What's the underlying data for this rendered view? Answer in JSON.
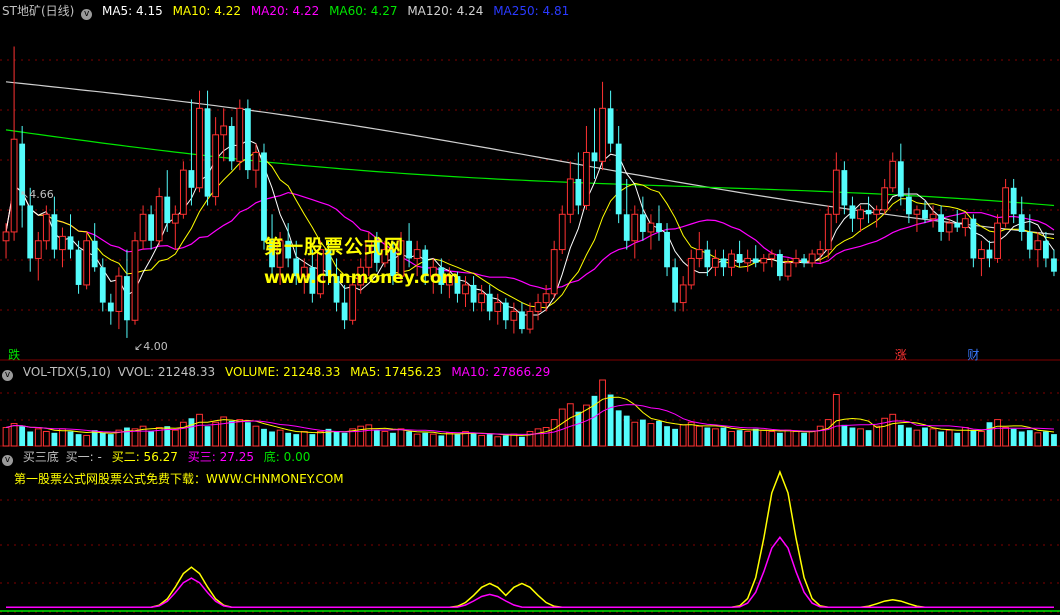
{
  "colors": {
    "up": "#ff3232",
    "down": "#54fcfc",
    "ma5": "#ffffff",
    "ma10": "#ffff00",
    "ma20": "#ff00ff",
    "ma60": "#00e600",
    "ma120": "#d0d0d0",
    "ma250": "#2a3aff",
    "grid": "#800000",
    "label": "#c0c0c0"
  },
  "main_header": {
    "title": "ST地矿(日线)",
    "items": [
      {
        "text": "MA5: 4.15",
        "color": "#ffffff"
      },
      {
        "text": "MA10: 4.22",
        "color": "#ffff00"
      },
      {
        "text": "MA20: 4.22",
        "color": "#ff00ff"
      },
      {
        "text": "MA60: 4.27",
        "color": "#00e600"
      },
      {
        "text": "MA120: 4.24",
        "color": "#d0d0d0"
      },
      {
        "text": "MA250: 4.81",
        "color": "#2a3aff"
      }
    ]
  },
  "volume_header": {
    "title": "VOL-TDX(5,10)",
    "items": [
      {
        "text": "VVOL: 21248.33",
        "color": "#c0c0c0"
      },
      {
        "text": "VOLUME: 21248.33",
        "color": "#ffff00"
      },
      {
        "text": "MA5: 17456.23",
        "color": "#ffff00"
      },
      {
        "text": "MA10: 27866.29",
        "color": "#ff00ff"
      }
    ]
  },
  "indicator_header": {
    "title": "买三底",
    "items": [
      {
        "text": "买一: -",
        "color": "#c0c0c0"
      },
      {
        "text": "买二: 56.27",
        "color": "#ffff00"
      },
      {
        "text": "买三: 27.25",
        "color": "#ff00ff"
      },
      {
        "text": "底: 0.00",
        "color": "#00e600"
      }
    ]
  },
  "watermark": {
    "line1": "第一股票公式网",
    "line2": "www.chnmoney.com"
  },
  "indicator_note": "第一股票公式网股票公式免费下载：WWW.CHNMONEY.COM",
  "price_annotations": {
    "high": "4.66",
    "low": "4.00"
  },
  "event_tags": [
    {
      "text": "跌",
      "color": "#00e600",
      "index": 1
    },
    {
      "text": "涨",
      "color": "#ff3232",
      "index": 111
    },
    {
      "text": "财",
      "color": "#3a7aff",
      "index": 120
    }
  ],
  "chart_data": [
    {
      "type": "candlestick",
      "series": [
        {
          "name": "MA5"
        },
        {
          "name": "MA10"
        },
        {
          "name": "MA20"
        },
        {
          "name": "MA60"
        },
        {
          "name": "MA120"
        },
        {
          "name": "MA250"
        }
      ],
      "ylim": [
        3.95,
        4.72
      ],
      "ma120_start": 4.58,
      "ma120_end": 4.24,
      "ma250_start": 5.0,
      "ma250_end": 4.81,
      "ma60_start": 4.48,
      "ma60_end": 4.27,
      "candles": [
        [
          4.22,
          4.26,
          4.18,
          4.24
        ],
        [
          4.24,
          4.66,
          4.22,
          4.45
        ],
        [
          4.44,
          4.48,
          4.25,
          4.3
        ],
        [
          4.3,
          4.34,
          4.15,
          4.18
        ],
        [
          4.18,
          4.24,
          4.13,
          4.22
        ],
        [
          4.22,
          4.3,
          4.2,
          4.28
        ],
        [
          4.28,
          4.32,
          4.18,
          4.2
        ],
        [
          4.2,
          4.25,
          4.16,
          4.23
        ],
        [
          4.23,
          4.28,
          4.18,
          4.2
        ],
        [
          4.2,
          4.22,
          4.1,
          4.12
        ],
        [
          4.12,
          4.24,
          4.11,
          4.22
        ],
        [
          4.22,
          4.26,
          4.15,
          4.16
        ],
        [
          4.16,
          4.18,
          4.06,
          4.08
        ],
        [
          4.08,
          4.1,
          4.03,
          4.06
        ],
        [
          4.06,
          4.16,
          4.02,
          4.14
        ],
        [
          4.14,
          4.2,
          4.0,
          4.04
        ],
        [
          4.04,
          4.24,
          4.03,
          4.22
        ],
        [
          4.22,
          4.3,
          4.2,
          4.28
        ],
        [
          4.28,
          4.3,
          4.2,
          4.22
        ],
        [
          4.22,
          4.34,
          4.21,
          4.32
        ],
        [
          4.32,
          4.38,
          4.24,
          4.26
        ],
        [
          4.26,
          4.3,
          4.2,
          4.28
        ],
        [
          4.28,
          4.4,
          4.27,
          4.38
        ],
        [
          4.38,
          4.54,
          4.3,
          4.34
        ],
        [
          4.34,
          4.56,
          4.33,
          4.52
        ],
        [
          4.52,
          4.56,
          4.3,
          4.32
        ],
        [
          4.32,
          4.5,
          4.3,
          4.46
        ],
        [
          4.46,
          4.52,
          4.4,
          4.48
        ],
        [
          4.48,
          4.5,
          4.38,
          4.4
        ],
        [
          4.4,
          4.54,
          4.38,
          4.52
        ],
        [
          4.52,
          4.54,
          4.36,
          4.38
        ],
        [
          4.38,
          4.44,
          4.34,
          4.42
        ],
        [
          4.42,
          4.44,
          4.2,
          4.22
        ],
        [
          4.22,
          4.28,
          4.14,
          4.16
        ],
        [
          4.16,
          4.24,
          4.12,
          4.22
        ],
        [
          4.22,
          4.26,
          4.16,
          4.18
        ],
        [
          4.18,
          4.22,
          4.12,
          4.14
        ],
        [
          4.14,
          4.18,
          4.1,
          4.16
        ],
        [
          4.16,
          4.2,
          4.08,
          4.1
        ],
        [
          4.1,
          4.22,
          4.09,
          4.2
        ],
        [
          4.2,
          4.22,
          4.12,
          4.14
        ],
        [
          4.14,
          4.18,
          4.06,
          4.08
        ],
        [
          4.08,
          4.12,
          4.02,
          4.04
        ],
        [
          4.04,
          4.14,
          4.03,
          4.12
        ],
        [
          4.12,
          4.18,
          4.1,
          4.16
        ],
        [
          4.16,
          4.24,
          4.14,
          4.22
        ],
        [
          4.22,
          4.24,
          4.15,
          4.17
        ],
        [
          4.17,
          4.22,
          4.16,
          4.2
        ],
        [
          4.2,
          4.22,
          4.12,
          4.14
        ],
        [
          4.14,
          4.24,
          4.13,
          4.22
        ],
        [
          4.22,
          4.26,
          4.16,
          4.18
        ],
        [
          4.18,
          4.22,
          4.14,
          4.2
        ],
        [
          4.2,
          4.21,
          4.12,
          4.14
        ],
        [
          4.14,
          4.18,
          4.1,
          4.16
        ],
        [
          4.16,
          4.18,
          4.1,
          4.12
        ],
        [
          4.12,
          4.16,
          4.09,
          4.14
        ],
        [
          4.14,
          4.15,
          4.08,
          4.1
        ],
        [
          4.1,
          4.14,
          4.07,
          4.12
        ],
        [
          4.12,
          4.14,
          4.06,
          4.08
        ],
        [
          4.08,
          4.12,
          4.06,
          4.1
        ],
        [
          4.1,
          4.12,
          4.04,
          4.06
        ],
        [
          4.06,
          4.1,
          4.03,
          4.08
        ],
        [
          4.08,
          4.09,
          4.02,
          4.04
        ],
        [
          4.04,
          4.08,
          4.01,
          4.06
        ],
        [
          4.06,
          4.08,
          4.01,
          4.02
        ],
        [
          4.02,
          4.08,
          4.01,
          4.06
        ],
        [
          4.06,
          4.1,
          4.04,
          4.08
        ],
        [
          4.08,
          4.12,
          4.06,
          4.1
        ],
        [
          4.1,
          4.22,
          4.09,
          4.2
        ],
        [
          4.2,
          4.3,
          4.19,
          4.28
        ],
        [
          4.28,
          4.4,
          4.26,
          4.36
        ],
        [
          4.36,
          4.42,
          4.28,
          4.3
        ],
        [
          4.3,
          4.48,
          4.29,
          4.42
        ],
        [
          4.42,
          4.52,
          4.36,
          4.4
        ],
        [
          4.4,
          4.58,
          4.38,
          4.52
        ],
        [
          4.52,
          4.56,
          4.42,
          4.44
        ],
        [
          4.44,
          4.48,
          4.26,
          4.28
        ],
        [
          4.28,
          4.36,
          4.2,
          4.22
        ],
        [
          4.22,
          4.3,
          4.18,
          4.28
        ],
        [
          4.28,
          4.32,
          4.22,
          4.24
        ],
        [
          4.24,
          4.28,
          4.2,
          4.26
        ],
        [
          4.26,
          4.3,
          4.22,
          4.24
        ],
        [
          4.24,
          4.26,
          4.14,
          4.16
        ],
        [
          4.16,
          4.18,
          4.06,
          4.08
        ],
        [
          4.08,
          4.14,
          4.06,
          4.12
        ],
        [
          4.12,
          4.2,
          4.11,
          4.18
        ],
        [
          4.18,
          4.24,
          4.16,
          4.2
        ],
        [
          4.2,
          4.22,
          4.14,
          4.16
        ],
        [
          4.16,
          4.2,
          4.14,
          4.18
        ],
        [
          4.18,
          4.2,
          4.14,
          4.16
        ],
        [
          4.16,
          4.2,
          4.14,
          4.19
        ],
        [
          4.19,
          4.22,
          4.16,
          4.17
        ],
        [
          4.17,
          4.2,
          4.15,
          4.18
        ],
        [
          4.18,
          4.21,
          4.16,
          4.17
        ],
        [
          4.17,
          4.19,
          4.15,
          4.18
        ],
        [
          4.18,
          4.2,
          4.16,
          4.19
        ],
        [
          4.19,
          4.2,
          4.13,
          4.14
        ],
        [
          4.14,
          4.18,
          4.13,
          4.17
        ],
        [
          4.17,
          4.2,
          4.16,
          4.18
        ],
        [
          4.18,
          4.19,
          4.16,
          4.17
        ],
        [
          4.17,
          4.2,
          4.16,
          4.19
        ],
        [
          4.19,
          4.22,
          4.17,
          4.2
        ],
        [
          4.2,
          4.3,
          4.18,
          4.28
        ],
        [
          4.28,
          4.42,
          4.26,
          4.38
        ],
        [
          4.38,
          4.4,
          4.28,
          4.3
        ],
        [
          4.3,
          4.32,
          4.24,
          4.27
        ],
        [
          4.27,
          4.3,
          4.24,
          4.29
        ],
        [
          4.29,
          4.32,
          4.26,
          4.28
        ],
        [
          4.28,
          4.3,
          4.25,
          4.29
        ],
        [
          4.29,
          4.36,
          4.28,
          4.34
        ],
        [
          4.34,
          4.42,
          4.33,
          4.4
        ],
        [
          4.4,
          4.44,
          4.3,
          4.32
        ],
        [
          4.32,
          4.34,
          4.26,
          4.28
        ],
        [
          4.28,
          4.3,
          4.24,
          4.29
        ],
        [
          4.29,
          4.31,
          4.26,
          4.27
        ],
        [
          4.27,
          4.3,
          4.25,
          4.28
        ],
        [
          4.28,
          4.3,
          4.22,
          4.24
        ],
        [
          4.24,
          4.27,
          4.22,
          4.26
        ],
        [
          4.26,
          4.29,
          4.24,
          4.25
        ],
        [
          4.25,
          4.28,
          4.23,
          4.27
        ],
        [
          4.27,
          4.28,
          4.16,
          4.18
        ],
        [
          4.18,
          4.22,
          4.14,
          4.2
        ],
        [
          4.2,
          4.22,
          4.16,
          4.18
        ],
        [
          4.18,
          4.28,
          4.17,
          4.26
        ],
        [
          4.26,
          4.36,
          4.25,
          4.34
        ],
        [
          4.34,
          4.36,
          4.26,
          4.28
        ],
        [
          4.28,
          4.32,
          4.22,
          4.24
        ],
        [
          4.24,
          4.28,
          4.18,
          4.2
        ],
        [
          4.2,
          4.24,
          4.16,
          4.22
        ],
        [
          4.22,
          4.24,
          4.16,
          4.18
        ],
        [
          4.18,
          4.2,
          4.14,
          4.15
        ]
      ]
    },
    {
      "type": "bar",
      "title": "VOL-TDX(5,10)",
      "ylim": [
        0,
        100000
      ],
      "series": [
        {
          "name": "VOLUME"
        },
        {
          "name": "MA5"
        },
        {
          "name": "MA10"
        }
      ],
      "volume": [
        28,
        34,
        30,
        22,
        26,
        22,
        20,
        26,
        22,
        18,
        16,
        24,
        20,
        18,
        24,
        28,
        26,
        30,
        22,
        28,
        30,
        24,
        36,
        42,
        48,
        30,
        36,
        44,
        38,
        40,
        36,
        30,
        26,
        22,
        24,
        20,
        18,
        22,
        18,
        22,
        26,
        22,
        20,
        26,
        30,
        32,
        24,
        22,
        20,
        26,
        22,
        18,
        20,
        18,
        16,
        20,
        18,
        22,
        20,
        16,
        18,
        14,
        16,
        18,
        14,
        22,
        26,
        28,
        40,
        56,
        64,
        52,
        62,
        76,
        100,
        78,
        54,
        46,
        36,
        40,
        34,
        38,
        30,
        26,
        32,
        36,
        30,
        28,
        26,
        28,
        22,
        24,
        22,
        26,
        24,
        22,
        20,
        24,
        22,
        20,
        22,
        30,
        40,
        78,
        32,
        28,
        26,
        24,
        30,
        42,
        48,
        32,
        28,
        24,
        28,
        26,
        22,
        24,
        20,
        28,
        24,
        22,
        36,
        40,
        28,
        26,
        22,
        24,
        20,
        22,
        18
      ]
    },
    {
      "type": "line",
      "title": "买三底",
      "ylim": [
        0,
        100
      ],
      "series": [
        {
          "name": "买二",
          "color": "#ffff00",
          "peaks": [
            [
              23,
              30
            ],
            [
              60,
              18
            ],
            [
              64,
              18
            ],
            [
              96,
              100
            ],
            [
              110,
              6
            ]
          ]
        },
        {
          "name": "买三",
          "color": "#ff00ff",
          "peaks": [
            [
              23,
              22
            ],
            [
              60,
              10
            ],
            [
              96,
              52
            ]
          ]
        },
        {
          "name": "底",
          "color": "#00e600"
        }
      ]
    }
  ]
}
